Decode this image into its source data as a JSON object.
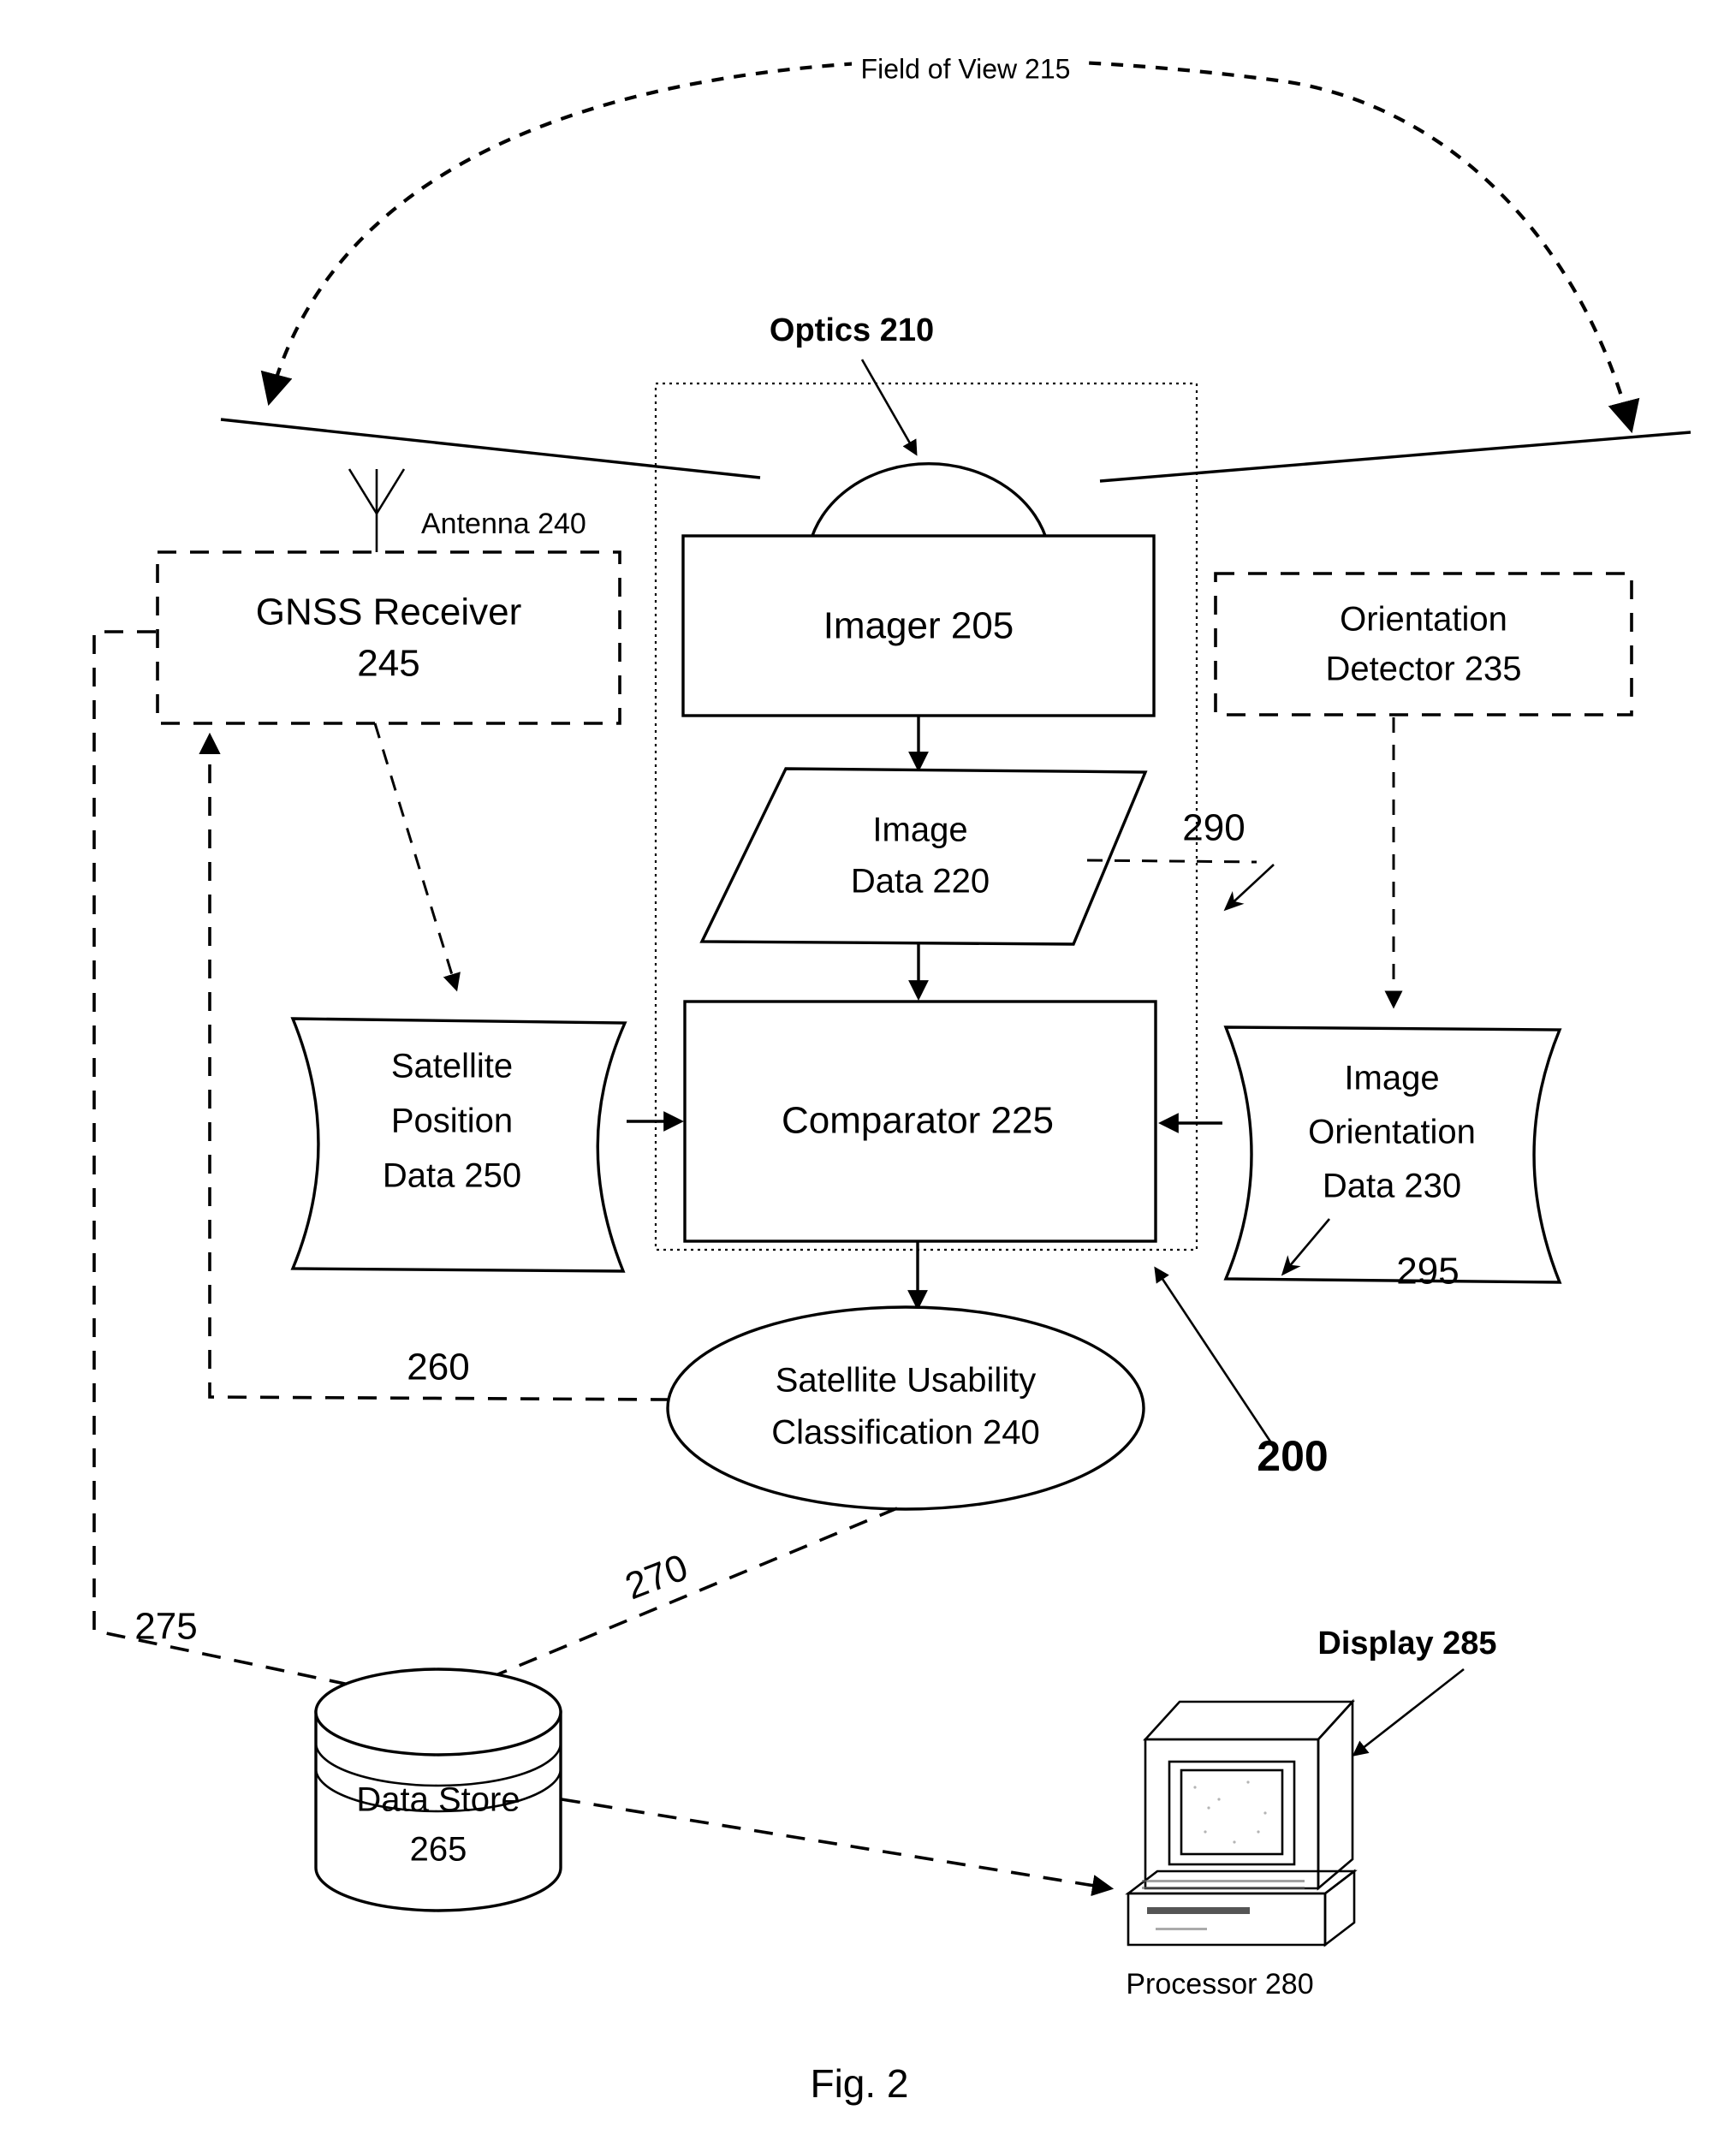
{
  "figure": {
    "caption": "Fig. 2",
    "system_ref": "200"
  },
  "annotations": {
    "field_of_view": "Field of View 215",
    "optics": "Optics 210",
    "antenna": "Antenna 240",
    "display": "Display 285",
    "processor": "Processor 280"
  },
  "nodes": {
    "gnss_receiver": {
      "line1": "GNSS Receiver",
      "line2": "245"
    },
    "imager": {
      "line1": "Imager 205"
    },
    "orientation_detector": {
      "line1": "Orientation",
      "line2": "Detector 235"
    },
    "image_data": {
      "line1": "Image",
      "line2": "Data 220"
    },
    "satellite_position_data": {
      "line1": "Satellite",
      "line2": "Position",
      "line3": "Data 250"
    },
    "comparator": {
      "line1": "Comparator 225"
    },
    "image_orientation_data": {
      "line1": "Image",
      "line2": "Orientation",
      "line3": "Data 230"
    },
    "satellite_usability": {
      "line1": "Satellite Usability",
      "line2": "Classification 240"
    },
    "data_store": {
      "line1": "Data Store",
      "line2": "265"
    }
  },
  "reference_numerals": {
    "image_data_flow": "290",
    "orientation_flow": "295",
    "feedback_to_gnss": "260",
    "classification_to_store": "270",
    "gnss_to_store": "275",
    "system": "200"
  },
  "colors": {
    "ink": "#000000",
    "paper": "#ffffff"
  }
}
